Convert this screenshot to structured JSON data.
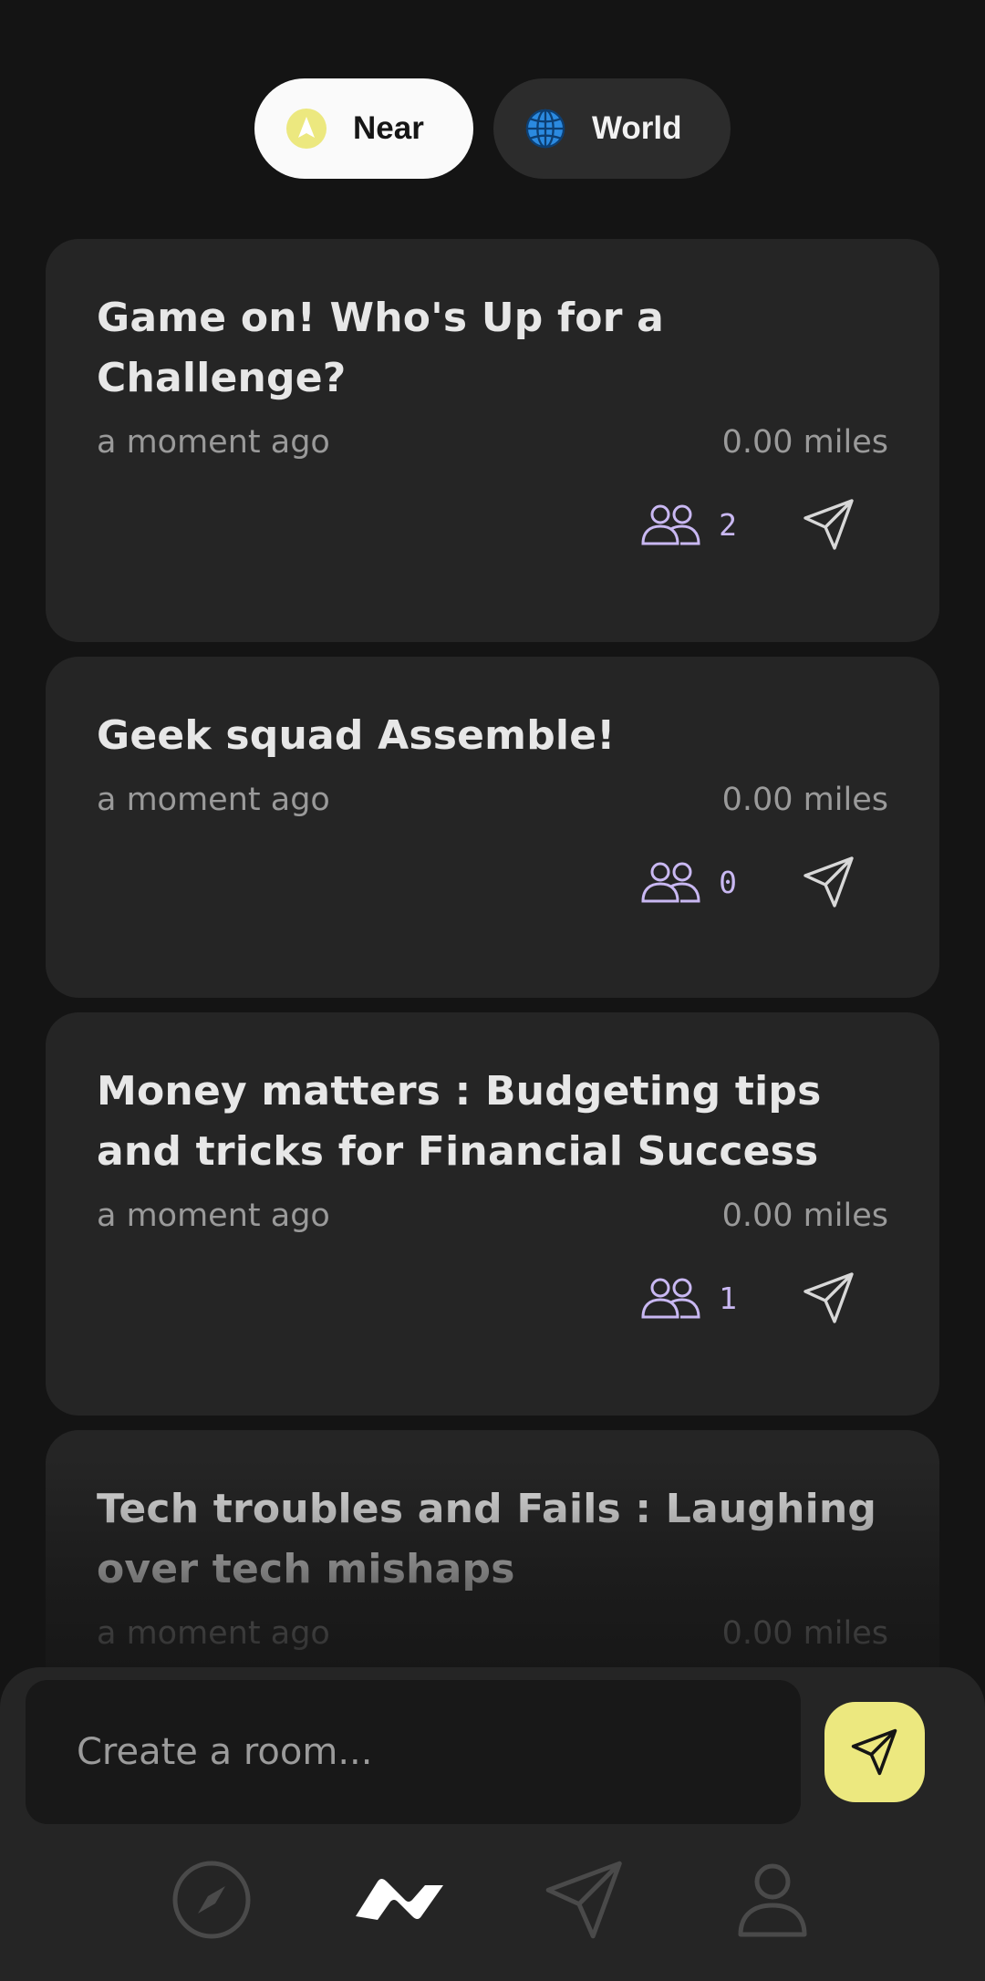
{
  "toggle": {
    "near_label": "Near",
    "world_label": "World",
    "active": "near"
  },
  "rooms": [
    {
      "title": "Game on! Who's Up for a Challenge?",
      "time": "a moment ago",
      "distance": "0.00 miles",
      "members": "2"
    },
    {
      "title": "Geek squad Assemble!",
      "time": "a moment ago",
      "distance": "0.00 miles",
      "members": "0"
    },
    {
      "title": "Money matters : Budgeting tips and tricks for Financial Success",
      "time": "a moment ago",
      "distance": "0.00 miles",
      "members": "1"
    },
    {
      "title": "Tech troubles and Fails : Laughing over tech mishaps",
      "time": "a moment ago",
      "distance": "0.00 miles"
    }
  ],
  "composer": {
    "placeholder": "Create a room..."
  },
  "nav": {
    "items": [
      "compass-icon",
      "activity-icon",
      "send-icon",
      "profile-icon"
    ],
    "active": "activity-icon"
  },
  "colors": {
    "background": "#141414",
    "card": "#252525",
    "accent_yellow": "#ece87f",
    "members_purple": "#c9b8f2",
    "globe_blue": "#2b8ae0"
  }
}
